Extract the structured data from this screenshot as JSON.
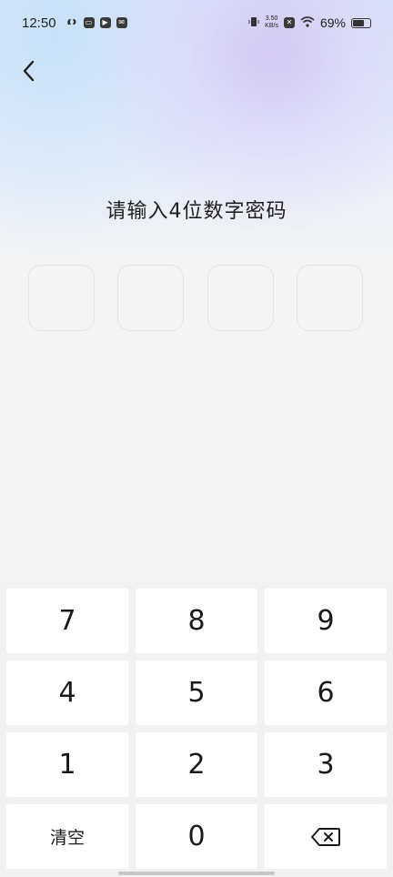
{
  "status_bar": {
    "time": "12:50",
    "net_speed_value": "3.50",
    "net_speed_unit": "KB/s",
    "battery": "69%",
    "battery_level": 0.69
  },
  "page": {
    "title": "请输入4位数字密码"
  },
  "keypad": {
    "rows": [
      [
        "7",
        "8",
        "9"
      ],
      [
        "4",
        "5",
        "6"
      ],
      [
        "1",
        "2",
        "3"
      ]
    ],
    "clear_label": "清空",
    "zero_label": "0",
    "backspace_icon": "backspace-icon"
  },
  "colors": {
    "text": "#1f1f1f",
    "pin_border": "#dde6f1",
    "key_bg": "#ffffff"
  }
}
